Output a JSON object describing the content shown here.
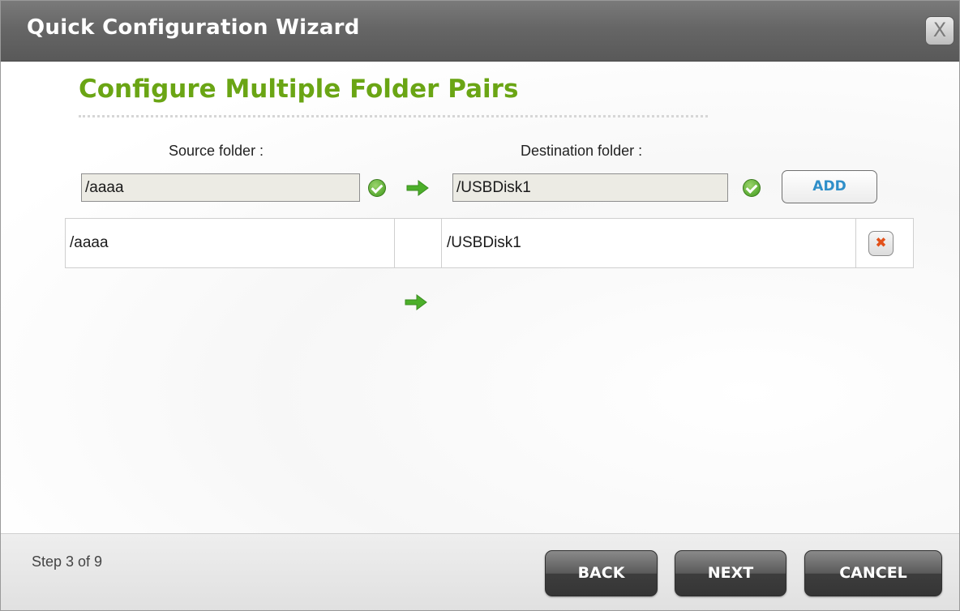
{
  "window": {
    "title": "Quick Configuration Wizard",
    "close_label": "X"
  },
  "page": {
    "heading": "Configure Multiple Folder Pairs",
    "source_label": "Source folder :",
    "destination_label": "Destination folder :",
    "source_value": "/aaaa",
    "destination_value": "/USBDisk1",
    "add_label": "ADD"
  },
  "pairs": [
    {
      "source": "/aaaa",
      "destination": "/USBDisk1"
    }
  ],
  "footer": {
    "step": "Step 3 of 9",
    "back_label": "BACK",
    "next_label": "NEXT",
    "cancel_label": "CANCEL"
  },
  "icons": {
    "valid": "check-circle-icon",
    "arrow": "arrow-right-icon",
    "delete": "delete-x-icon",
    "close": "close-icon"
  },
  "colors": {
    "heading": "#6aa514",
    "accent_blue": "#2f8fc9",
    "arrow_green": "#4caf2a",
    "delete_red": "#e2511a"
  }
}
